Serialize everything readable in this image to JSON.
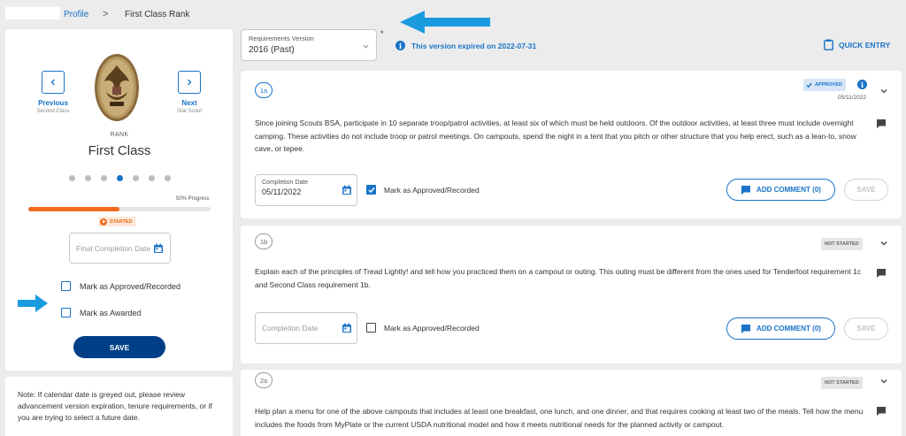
{
  "breadcrumb": {
    "profile": "Profile",
    "separator": ">",
    "current": "First Class Rank"
  },
  "rank_panel": {
    "prev_label": "Previous",
    "prev_sub": "Second Class",
    "next_label": "Next",
    "next_sub": "Star Scout",
    "rank_label": "RANK",
    "rank_name": "First Class",
    "dots_total": 7,
    "dots_active_index": 3,
    "progress_text": "50% Progress",
    "progress_fraction": 0.5,
    "status_badge": "STARTED",
    "final_date_placeholder": "Final Completion Date",
    "approved_label": "Mark as Approved/Recorded",
    "awarded_label": "Mark as Awarded",
    "save_label": "SAVE"
  },
  "note": "Note: If calendar date is greyed out, please review advancement version expiration, tenure requirements, or if you are trying to select a future date.",
  "version": {
    "label": "Requirements Version",
    "value": "2016 (Past)",
    "asterisk": "*",
    "expired_text": "This version expired on 2022-07-31"
  },
  "quick_entry": "QUICK ENTRY",
  "requirements": [
    {
      "num": "1a",
      "status": "APPROVED",
      "date": "05/11/2022",
      "text": "Since joining Scouts BSA, participate in 10 separate troop/patrol activities, at least six of which must be held outdoors. Of the outdoor activities, at least three must include overnight camping. These activities do not include troop or patrol meetings. On campouts, spend the night in a tent that you pitch or other structure that you help erect, such as a lean-to, snow cave, or tepee.",
      "completion_label": "Completion Date",
      "completion_value": "05/11/2022",
      "approved_label": "Mark as Approved/Recorded",
      "approved_checked": true,
      "add_comment": "ADD COMMENT (0)",
      "save": "SAVE"
    },
    {
      "num": "1b",
      "status": "NOT STARTED",
      "text": "Explain each of the principles of Tread Lightly! and tell how you practiced them on a campout or outing. This outing must be different from the ones used for Tenderfoot requirement 1c and Second Class requirement 1b.",
      "completion_placeholder": "Completion Date",
      "approved_label": "Mark as Approved/Recorded",
      "approved_checked": false,
      "add_comment": "ADD COMMENT (0)",
      "save": "SAVE"
    },
    {
      "num": "2a",
      "status": "NOT STARTED",
      "text": "Help plan a menu for one of the above campouts that includes at least one breakfast, one lunch, and one dinner, and that requires cooking at least two of the meals. Tell how the menu includes the foods from MyPlate or the current USDA nutritional model and how it meets nutritional needs for the planned activity or campout."
    }
  ],
  "colors": {
    "accent": "#1a73c8",
    "navy": "#003f87",
    "orange": "#f26a1b",
    "annotation_arrow": "#1a9be0"
  }
}
